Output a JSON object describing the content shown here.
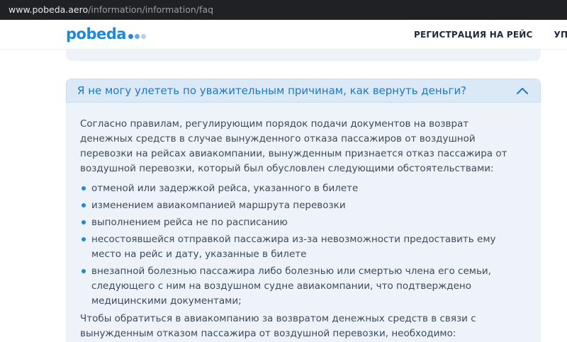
{
  "browser": {
    "url_host": "www.pobeda.aero",
    "url_path": "/information/information/faq"
  },
  "header": {
    "logo_text": "pobeda",
    "logo_dot_colors": [
      "#1e88d9",
      "#6aa9e0",
      "#b3d1ee"
    ],
    "nav_items": [
      "РЕГИСТРАЦИЯ НА РЕЙС",
      "УПРА"
    ]
  },
  "faq": {
    "question": "Я не могу улететь по уважительным причинам, как вернуть деньги?",
    "intro": "Согласно правилам, регулирующим порядок подачи документов на возврат денежных средств в случае вынужденного отказа пассажиров от воздушной перевозки на рейсах авиакомпании, вынужденным признается отказ пассажира от воздушной перевозки, который был обусловлен следующими обстоятельствами:",
    "bullets": [
      "отменой или задержкой рейса, указанного в билете",
      "изменением авиакомпанией маршрута перевозки",
      "выполнением рейса не по расписанию",
      "несостоявшейся отправкой пассажира из-за невозможности предоставить ему место на рейс и дату, указанные в билете",
      "внезапной болезнью пассажира либо болезнью или смертью члена его семьи, следующего с ним на воздушном судне авиакомпании, что подтверждено медицинскими документами;"
    ],
    "outro": "Чтобы обратиться в авиакомпанию за возвратом денежных средств в связи с вынужденным отказом пассажира от воздушной перевозки, необходимо:"
  },
  "colors": {
    "brand_blue": "#1e88d9",
    "question_bg": "#dbe9f6",
    "answer_bg": "#eef3f9"
  }
}
